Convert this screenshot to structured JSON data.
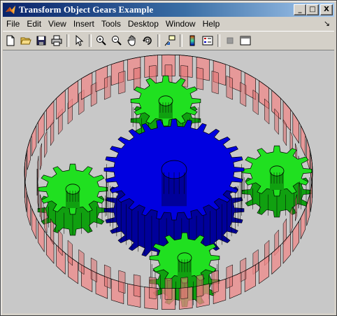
{
  "window": {
    "title": "Transform Object Gears Example",
    "caption_buttons": {
      "minimize": "_",
      "maximize": "□",
      "close": "X"
    }
  },
  "menu": {
    "items": [
      "File",
      "Edit",
      "View",
      "Insert",
      "Tools",
      "Desktop",
      "Window",
      "Help"
    ],
    "overflow_arrow": "↘"
  },
  "toolbar": {
    "buttons": [
      "new-figure",
      "open-file",
      "save",
      "print",
      "edit-plot",
      "zoom-in",
      "zoom-out",
      "pan",
      "rotate-3d",
      "data-cursor",
      "insert-colorbar",
      "insert-legend",
      "hide-plot-tools",
      "show-plot-tools"
    ]
  },
  "colors": {
    "titlebar_start": "#0a246a",
    "titlebar_end": "#a6caf0",
    "ring_gear": "#f08a8a",
    "sun_gear": "#0000e0",
    "planet_gear": "#20e020",
    "figure_bg": "#c8c8c8"
  }
}
